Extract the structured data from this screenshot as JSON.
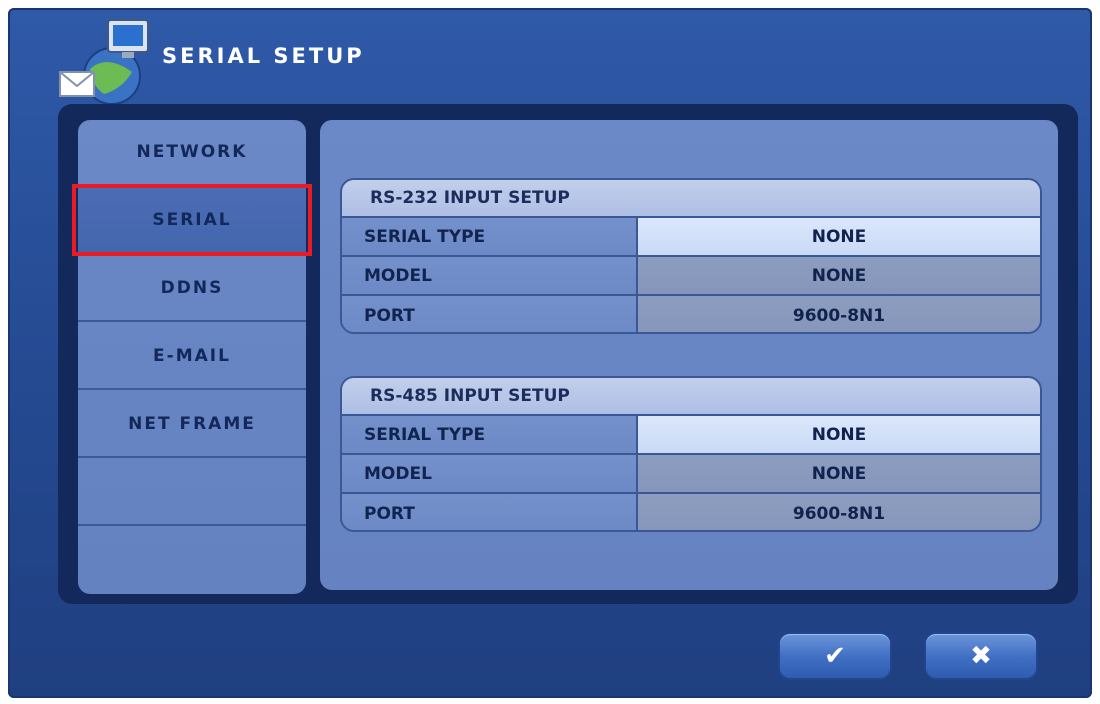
{
  "window": {
    "title": "SERIAL SETUP"
  },
  "sidebar": {
    "items": [
      {
        "label": "NETWORK",
        "active": false
      },
      {
        "label": "SERIAL",
        "active": true
      },
      {
        "label": "DDNS",
        "active": false
      },
      {
        "label": "E-MAIL",
        "active": false
      },
      {
        "label": "NET FRAME",
        "active": false
      },
      {
        "label": "",
        "active": false
      },
      {
        "label": "",
        "active": false
      }
    ]
  },
  "rs232": {
    "header": "RS-232 INPUT SETUP",
    "rows": [
      {
        "label": "SERIAL TYPE",
        "value": "NONE"
      },
      {
        "label": "MODEL",
        "value": "NONE"
      },
      {
        "label": "PORT",
        "value": "9600-8N1"
      }
    ]
  },
  "rs485": {
    "header": "RS-485 INPUT SETUP",
    "rows": [
      {
        "label": "SERIAL TYPE",
        "value": "NONE"
      },
      {
        "label": "MODEL",
        "value": "NONE"
      },
      {
        "label": "PORT",
        "value": "9600-8N1"
      }
    ]
  },
  "buttons": {
    "ok_icon": "checkmark-icon",
    "cancel_icon": "close-icon",
    "ok_glyph": "✔",
    "cancel_glyph": "✖"
  },
  "colors": {
    "highlight": "#e81c24",
    "window_bg": "#2f5aa8",
    "selected_value_bg": "#dbe7fb"
  }
}
